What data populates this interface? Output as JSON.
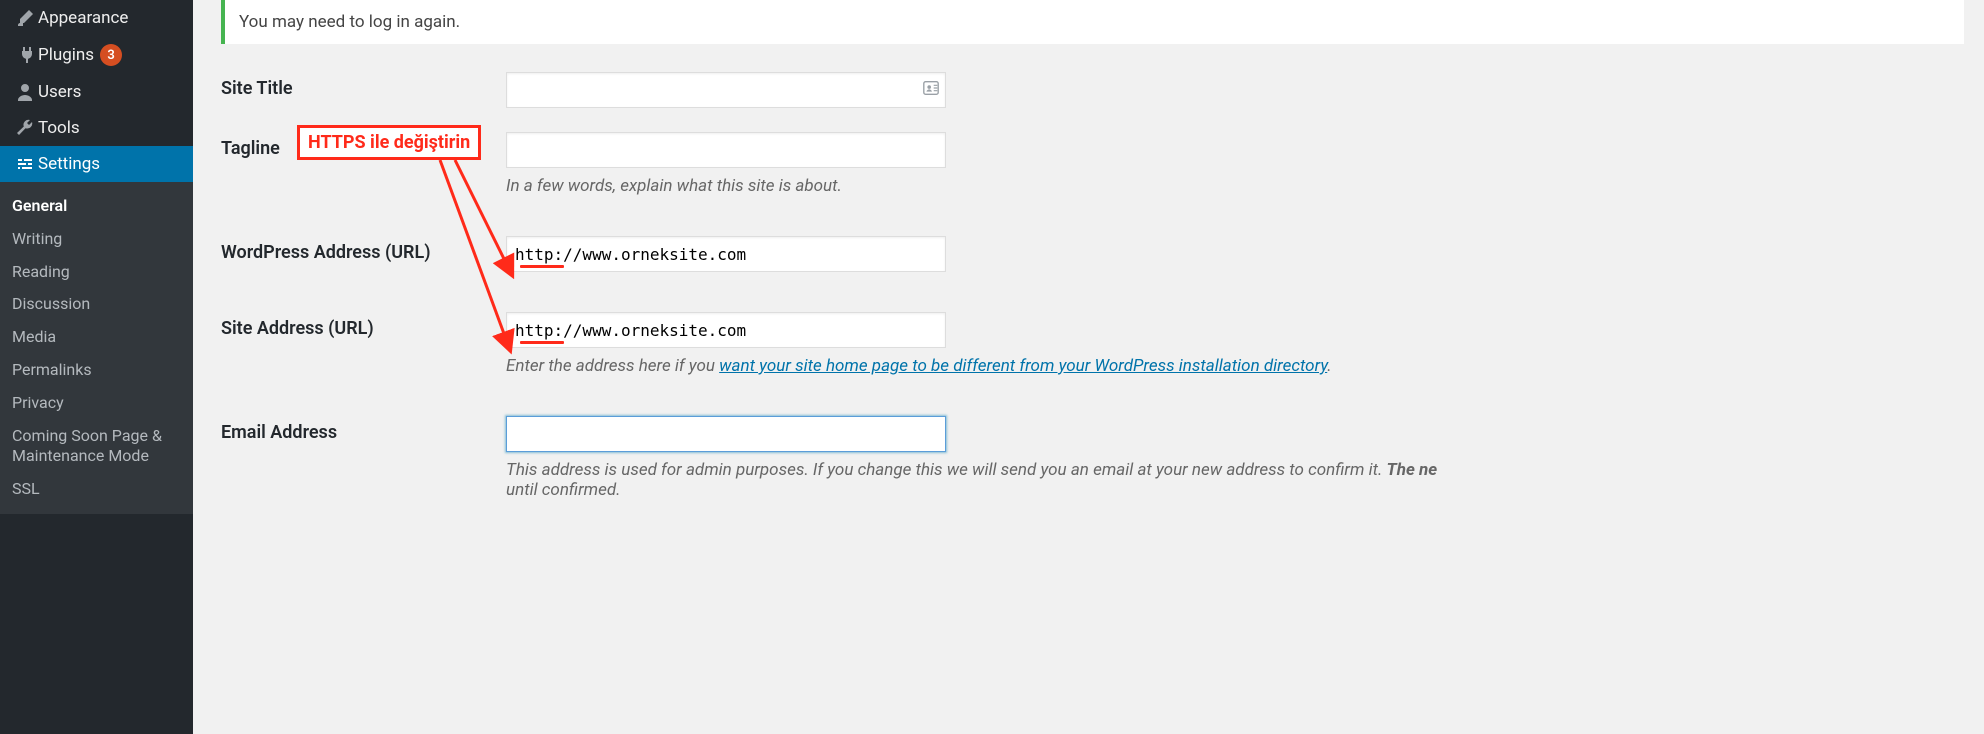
{
  "sidebar": {
    "items": [
      {
        "label": "Appearance",
        "icon": "brush-icon"
      },
      {
        "label": "Plugins",
        "icon": "plugin-icon",
        "badge": "3"
      },
      {
        "label": "Users",
        "icon": "user-icon"
      },
      {
        "label": "Tools",
        "icon": "wrench-icon"
      },
      {
        "label": "Settings",
        "icon": "sliders-icon",
        "current": true
      }
    ],
    "settings_submenu": [
      {
        "label": "General",
        "current": true
      },
      {
        "label": "Writing"
      },
      {
        "label": "Reading"
      },
      {
        "label": "Discussion"
      },
      {
        "label": "Media"
      },
      {
        "label": "Permalinks"
      },
      {
        "label": "Privacy"
      },
      {
        "label": "Coming Soon Page & Maintenance Mode"
      },
      {
        "label": "SSL"
      }
    ]
  },
  "notice_text": "You may need to log in again.",
  "form": {
    "site_title": {
      "label": "Site Title",
      "value": ""
    },
    "tagline": {
      "label": "Tagline",
      "value": "",
      "desc": "In a few words, explain what this site is about."
    },
    "wp_url": {
      "label": "WordPress Address (URL)",
      "value": "http://www.orneksite.com"
    },
    "site_url": {
      "label": "Site Address (URL)",
      "value": "http://www.orneksite.com",
      "desc_pre": "Enter the address here if you ",
      "desc_link": "want your site home page to be different from your WordPress installation directory",
      "desc_post": "."
    },
    "email": {
      "label": "Email Address",
      "value": "",
      "desc_pre": "This address is used for admin purposes. If you change this we will send you an email at your new address to confirm it. ",
      "desc_strong": "The ne",
      "desc_post2": "until confirmed."
    }
  },
  "annotation": {
    "callout": "HTTPS ile değiştirin"
  }
}
